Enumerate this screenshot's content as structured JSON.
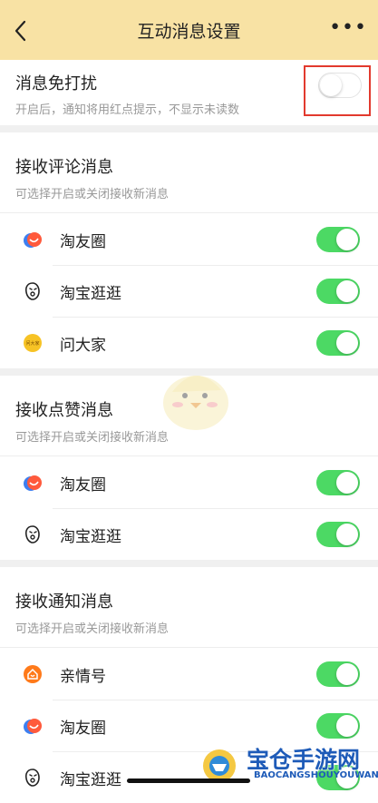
{
  "header": {
    "title": "互动消息设置",
    "back_icon": "chevron-left-icon",
    "more_label": "•••"
  },
  "dnd": {
    "title": "消息免打扰",
    "subtitle": "开启后，通知将用红点提示，不显示未读数",
    "enabled": false
  },
  "sections": [
    {
      "title": "接收评论消息",
      "subtitle": "可选择开启或关闭接收新消息",
      "items": [
        {
          "label": "淘友圈",
          "icon": "taoyouquan-icon",
          "enabled": true
        },
        {
          "label": "淘宝逛逛",
          "icon": "taobao-guangguang-icon",
          "enabled": true
        },
        {
          "label": "问大家",
          "icon": "wendajia-icon",
          "enabled": true
        }
      ]
    },
    {
      "title": "接收点赞消息",
      "subtitle": "可选择开启或关闭接收新消息",
      "items": [
        {
          "label": "淘友圈",
          "icon": "taoyouquan-icon",
          "enabled": true
        },
        {
          "label": "淘宝逛逛",
          "icon": "taobao-guangguang-icon",
          "enabled": true
        }
      ]
    },
    {
      "title": "接收通知消息",
      "subtitle": "可选择开启或关闭接收新消息",
      "items": [
        {
          "label": "亲情号",
          "icon": "qinqinghao-icon",
          "enabled": true
        },
        {
          "label": "淘友圈",
          "icon": "taoyouquan-icon",
          "enabled": true
        },
        {
          "label": "淘宝逛逛",
          "icon": "taobao-guangguang-icon",
          "enabled": true
        }
      ]
    }
  ],
  "watermark": {
    "name": "宝仓手游网",
    "pinyin": "BAOCANGSHOUYOUWANG"
  },
  "wendajia_badge_text": "问大家",
  "colors": {
    "header_bg": "#f8e2a4",
    "toggle_on": "#4cd964",
    "highlight": "#e23a2e",
    "brand": "#1e5bb8"
  }
}
